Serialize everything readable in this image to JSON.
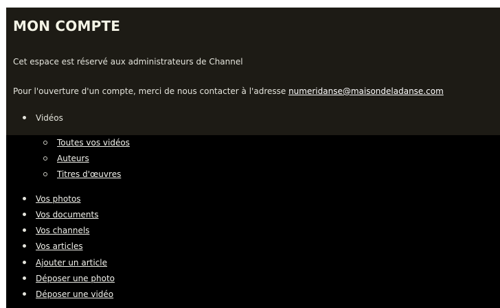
{
  "account": {
    "title": "MON COMPTE",
    "intro_text": "Cet espace est réservé aux administrateurs de Channel",
    "contact_prefix": "Pour l'ouverture d'un compte, merci de nous contacter à l'adresse ",
    "contact_email": "numeridanse@maisondeladanse.com"
  },
  "menu": {
    "videos": {
      "label": "Vidéos",
      "children": [
        {
          "label": "Toutes vos vidéos"
        },
        {
          "label": "Auteurs"
        },
        {
          "label": "Titres d'œuvres"
        }
      ]
    },
    "items": [
      {
        "label": "Vos photos"
      },
      {
        "label": "Vos documents"
      },
      {
        "label": "Vos channels"
      },
      {
        "label": "Vos articles"
      },
      {
        "label": "Ajouter un article"
      },
      {
        "label": "Déposer une photo"
      },
      {
        "label": "Déposer une vidéo"
      }
    ]
  }
}
